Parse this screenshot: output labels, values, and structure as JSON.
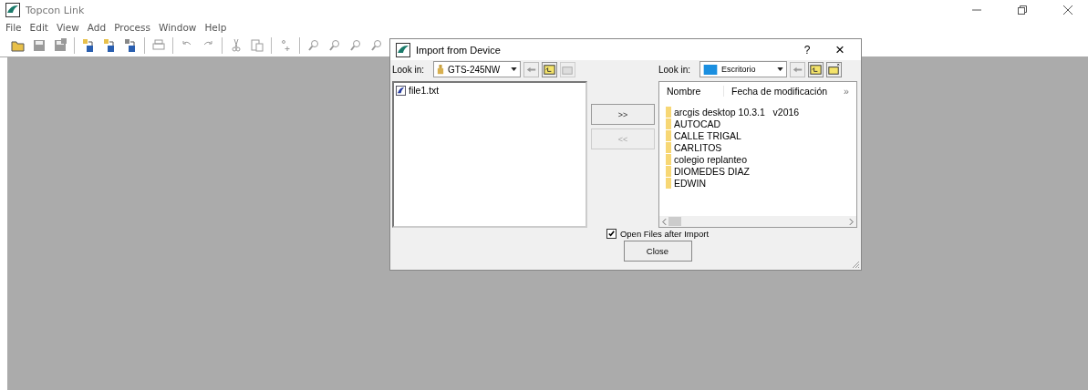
{
  "window": {
    "title": "Topcon Link"
  },
  "menu": [
    "File",
    "Edit",
    "View",
    "Add",
    "Process",
    "Window",
    "Help"
  ],
  "toolbar": [
    {
      "kind": "open",
      "disabled": false
    },
    {
      "kind": "save",
      "disabled": true
    },
    {
      "kind": "saveall",
      "disabled": true
    },
    {
      "kind": "sep"
    },
    {
      "kind": "import",
      "disabled": false
    },
    {
      "kind": "export",
      "disabled": false
    },
    {
      "kind": "convert",
      "disabled": false
    },
    {
      "kind": "sep"
    },
    {
      "kind": "print",
      "disabled": true
    },
    {
      "kind": "sep"
    },
    {
      "kind": "undo",
      "disabled": true
    },
    {
      "kind": "redo",
      "disabled": true
    },
    {
      "kind": "sep"
    },
    {
      "kind": "cut",
      "disabled": true
    },
    {
      "kind": "paste",
      "disabled": true
    },
    {
      "kind": "sep"
    },
    {
      "kind": "point",
      "disabled": true
    },
    {
      "kind": "sep"
    },
    {
      "kind": "zoom",
      "disabled": true
    },
    {
      "kind": "zoom",
      "disabled": true
    },
    {
      "kind": "zoom",
      "disabled": true
    },
    {
      "kind": "zoom",
      "disabled": true
    }
  ],
  "dialog": {
    "title": "Import from Device",
    "help": "?",
    "close": "×",
    "left": {
      "look_in_label": "Look in:",
      "location": "GTS-245NW",
      "files": [
        {
          "name": "file1.txt",
          "selected": false
        }
      ]
    },
    "transfer_buttons": [
      {
        "label": ">>",
        "disabled": false
      },
      {
        "label": "<<",
        "disabled": true
      }
    ],
    "right": {
      "look_in_label": "Look in:",
      "location": "Escritorio",
      "columns": [
        "Nombre",
        "Fecha de modificación"
      ],
      "more": "»",
      "folders": [
        {
          "name": "arcgis desktop 10.3.1   v2016"
        },
        {
          "name": "AUTOCAD"
        },
        {
          "name": "CALLE TRIGAL"
        },
        {
          "name": "CARLITOS"
        },
        {
          "name": "colegio replanteo"
        },
        {
          "name": "DIOMEDES DIAZ"
        },
        {
          "name": "EDWIN"
        }
      ]
    },
    "open_after_import": {
      "label": "Open Files after Import",
      "checked": true
    },
    "close_button": "Close"
  }
}
